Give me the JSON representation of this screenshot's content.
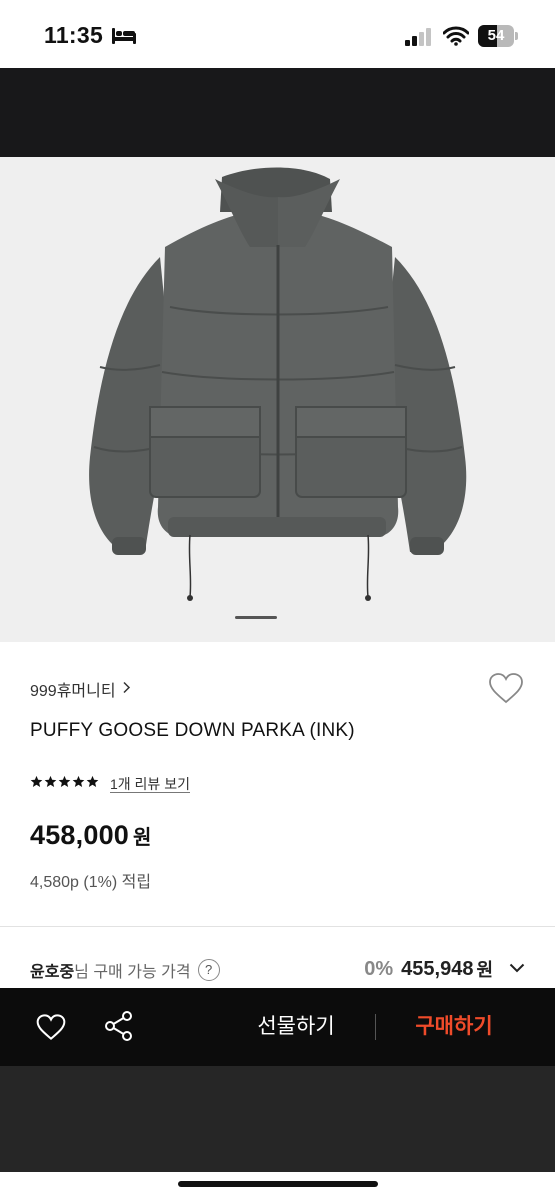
{
  "status_bar": {
    "time": "11:35",
    "battery": "54",
    "battery_level": 0.54
  },
  "product": {
    "brand": "999휴머니티",
    "name": "PUFFY GOOSE DOWN PARKA (INK)",
    "rating_stars": 5,
    "review_link": "1개 리뷰 보기",
    "price": "458,000",
    "price_unit": "원",
    "points": "4,580p (1%) 적립",
    "image_page_current": 1
  },
  "member_price": {
    "name": "윤호중",
    "label": "님 구매 가능 가격",
    "help": "?",
    "discount": "0%",
    "price": "455,948",
    "unit": "원"
  },
  "bottom_bar": {
    "gift_label": "선물하기",
    "buy_label": "구매하기"
  },
  "colors": {
    "buy_accent": "#ef4b2a",
    "dark_bar": "#0c0c0c",
    "hero_bg": "#efefef",
    "jacket": "#5c5f5e"
  },
  "icons": [
    "bed-icon",
    "signal-icon",
    "wifi-icon",
    "chevron-right-icon",
    "heart-icon",
    "star-icon",
    "question-icon",
    "chevron-down-icon",
    "share-icon"
  ]
}
